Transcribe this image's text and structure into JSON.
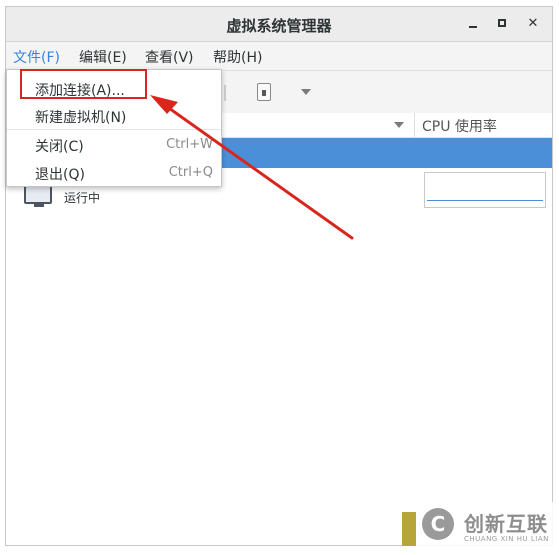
{
  "window": {
    "title": "虚拟系统管理器"
  },
  "menubar": {
    "items": [
      "文件(F)",
      "编辑(E)",
      "查看(V)",
      "帮助(H)"
    ]
  },
  "file_menu": {
    "items": [
      {
        "label": "添加连接(A)...",
        "accel": ""
      },
      {
        "label": "新建虚拟机(N)",
        "accel": ""
      },
      {
        "label": "关闭(C)",
        "accel": "Ctrl+W"
      },
      {
        "label": "退出(Q)",
        "accel": "Ctrl+Q"
      }
    ]
  },
  "table": {
    "cpu_column": "CPU 使用率"
  },
  "vm": {
    "status": "运行中"
  },
  "watermark": {
    "logo_glyph": "C",
    "cn": "创新互联",
    "en": "CHUANG XIN HU LIAN"
  },
  "colors": {
    "selection": "#4a90d9",
    "highlight_annotation": "#d9261c",
    "active_menu": "#3584e4"
  }
}
